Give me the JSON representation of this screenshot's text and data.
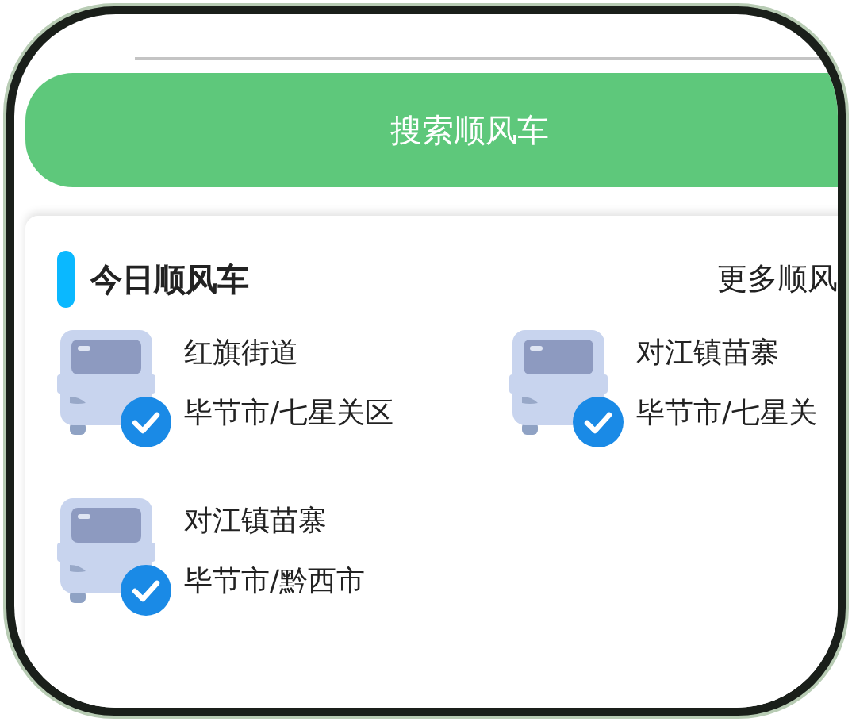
{
  "search_button": {
    "label": "搜索顺风车"
  },
  "section": {
    "title": "今日顺风车",
    "more_link": "更多顺风"
  },
  "rides": [
    {
      "place": "红旗街道",
      "region": "毕节市/七星关区",
      "verified": true
    },
    {
      "place": "对江镇苗寨",
      "region": "毕节市/七星关",
      "verified": true
    },
    {
      "place": "对江镇苗寨",
      "region": "毕节市/黔西市",
      "verified": true
    }
  ]
}
